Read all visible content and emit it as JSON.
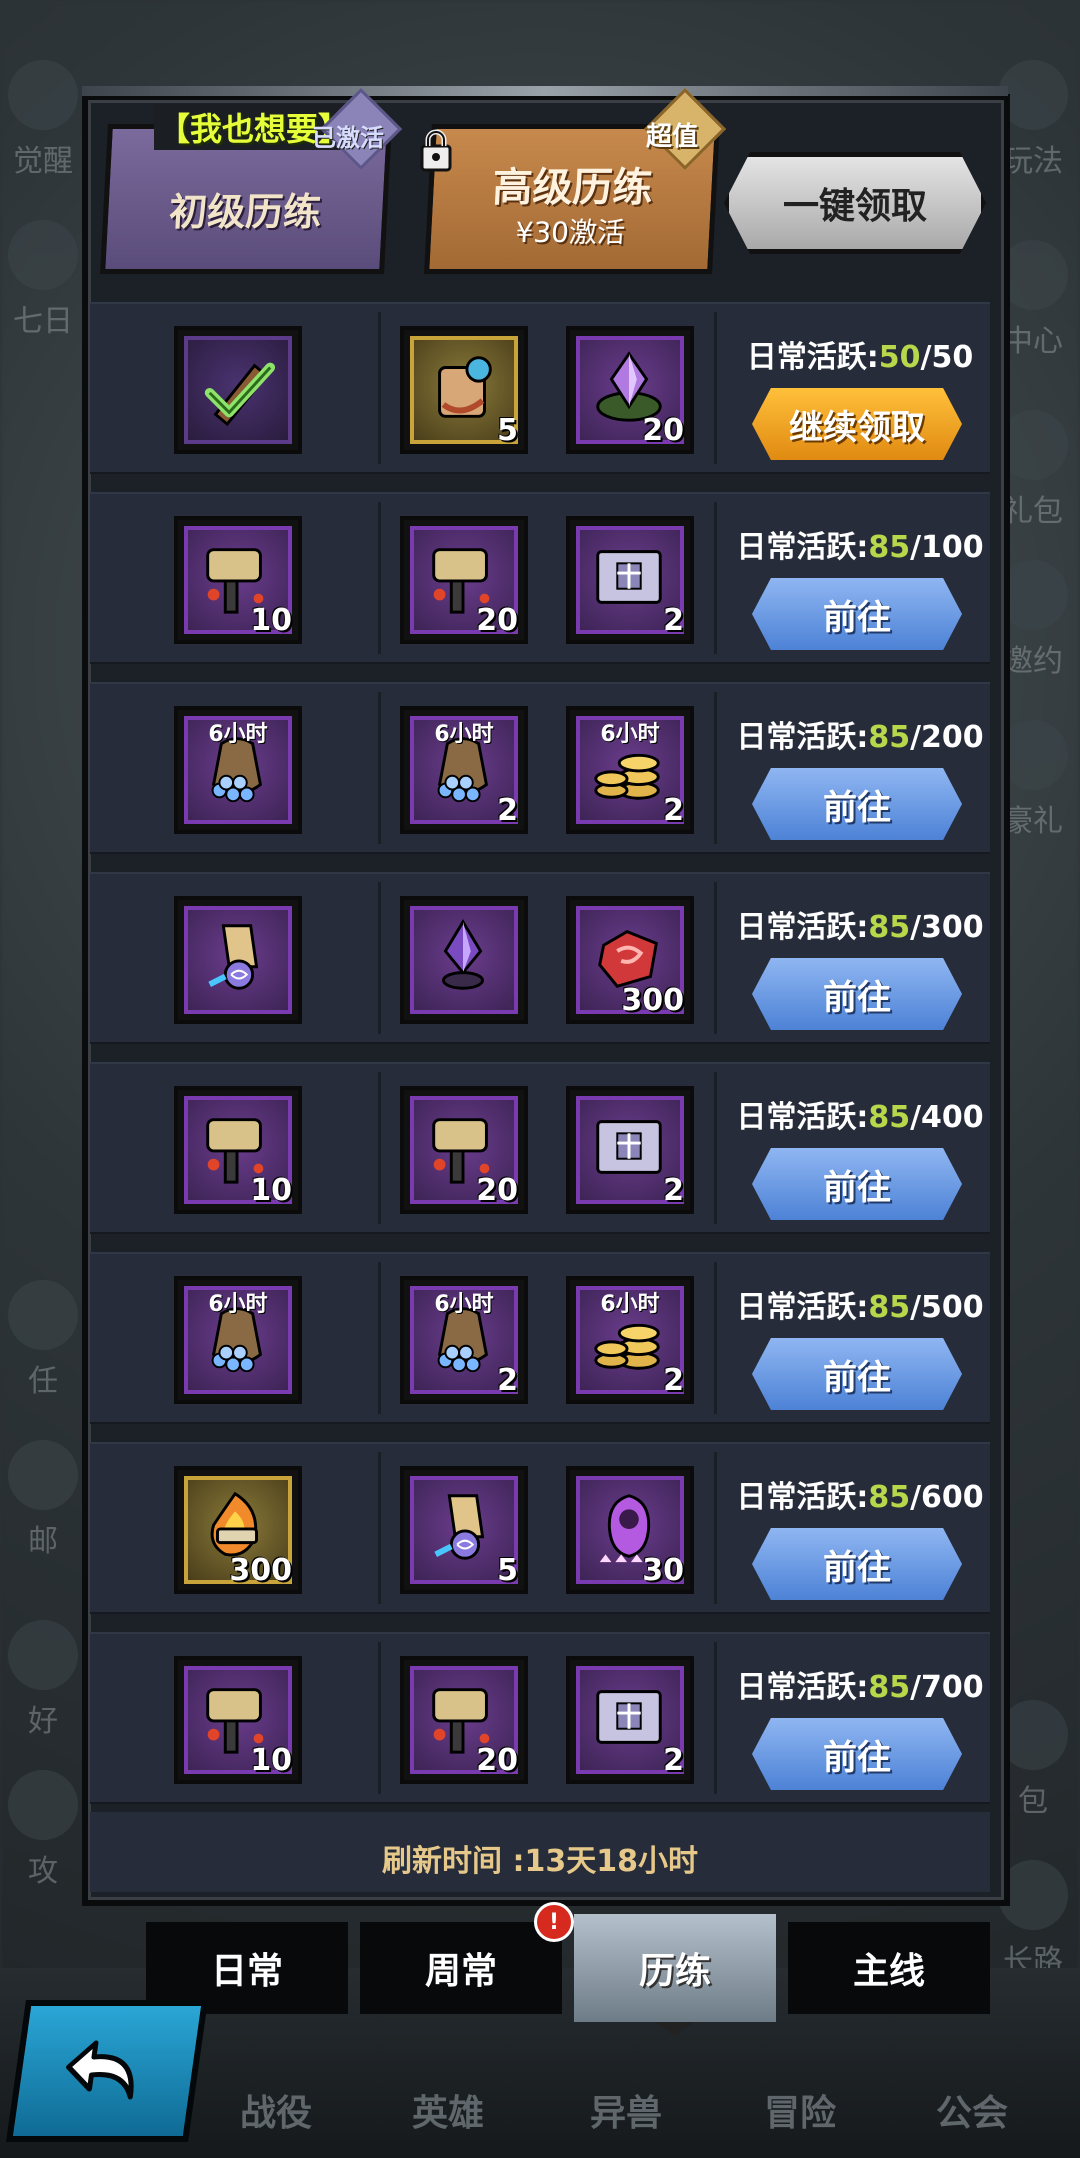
{
  "background": {
    "left_items": [
      "觉醒",
      "七日",
      "邮",
      "任",
      "好",
      "攻"
    ],
    "right_items": [
      "玩法",
      "中心",
      "礼包",
      "邀约",
      "豪礼",
      "包",
      "长路"
    ],
    "bottom_nav": [
      "战役",
      "英雄",
      "异兽",
      "冒险",
      "公会"
    ]
  },
  "header": {
    "want_label": "【我也想要】",
    "basic_tab_label": "初级历练",
    "basic_badge": "已激活",
    "advanced_tab_label": "高级历练",
    "advanced_price": "¥30激活",
    "advanced_badge": "超值",
    "claim_all_label": "一键领取"
  },
  "progress_prefix": "日常活跃:",
  "rows": [
    {
      "current": "50",
      "target": "/50",
      "button": "继续领取",
      "button_type": "continue",
      "items": [
        {
          "icon": "scroll-claimed-icon",
          "count": "",
          "timer": "",
          "frame": "dark",
          "claimed": true
        },
        {
          "icon": "gold-scroll-icon",
          "count": "5",
          "timer": "",
          "frame": "gold"
        },
        {
          "icon": "crystal-nest-icon",
          "count": "20",
          "timer": "",
          "frame": "purple"
        }
      ]
    },
    {
      "current": "85",
      "target": "/100",
      "button": "前往",
      "button_type": "go",
      "items": [
        {
          "icon": "hammer-icon",
          "count": "10",
          "timer": "",
          "frame": "purple"
        },
        {
          "icon": "hammer-icon",
          "count": "20",
          "timer": "",
          "frame": "purple"
        },
        {
          "icon": "gift-card-icon",
          "count": "2",
          "timer": "",
          "frame": "purple"
        }
      ]
    },
    {
      "current": "85",
      "target": "/200",
      "button": "前往",
      "button_type": "go",
      "items": [
        {
          "icon": "gem-bag-icon",
          "count": "",
          "timer": "6小时",
          "frame": "purple"
        },
        {
          "icon": "gem-bag-icon",
          "count": "2",
          "timer": "6小时",
          "frame": "purple"
        },
        {
          "icon": "gold-coins-icon",
          "count": "2",
          "timer": "6小时",
          "frame": "purple"
        }
      ]
    },
    {
      "current": "85",
      "target": "/300",
      "button": "前往",
      "button_type": "go",
      "items": [
        {
          "icon": "magic-scroll-icon",
          "count": "",
          "timer": "",
          "frame": "purple"
        },
        {
          "icon": "dark-crystal-icon",
          "count": "",
          "timer": "",
          "frame": "purple"
        },
        {
          "icon": "red-gem-icon",
          "count": "300",
          "timer": "",
          "frame": "purple"
        }
      ]
    },
    {
      "current": "85",
      "target": "/400",
      "button": "前往",
      "button_type": "go",
      "items": [
        {
          "icon": "hammer-icon",
          "count": "10",
          "timer": "",
          "frame": "purple"
        },
        {
          "icon": "hammer-icon",
          "count": "20",
          "timer": "",
          "frame": "purple"
        },
        {
          "icon": "gift-card-icon",
          "count": "2",
          "timer": "",
          "frame": "purple"
        }
      ]
    },
    {
      "current": "85",
      "target": "/500",
      "button": "前往",
      "button_type": "go",
      "items": [
        {
          "icon": "gem-bag-icon",
          "count": "",
          "timer": "6小时",
          "frame": "purple"
        },
        {
          "icon": "gem-bag-icon",
          "count": "2",
          "timer": "6小时",
          "frame": "purple"
        },
        {
          "icon": "gold-coins-icon",
          "count": "2",
          "timer": "6小时",
          "frame": "purple"
        }
      ]
    },
    {
      "current": "85",
      "target": "/600",
      "button": "前往",
      "button_type": "go",
      "items": [
        {
          "icon": "fire-scroll-icon",
          "count": "300",
          "timer": "",
          "frame": "gold"
        },
        {
          "icon": "magic-scroll-icon",
          "count": "5",
          "timer": "",
          "frame": "purple"
        },
        {
          "icon": "hero-shard-icon",
          "count": "30",
          "timer": "",
          "frame": "purple"
        }
      ]
    },
    {
      "current": "85",
      "target": "/700",
      "button": "前往",
      "button_type": "go",
      "items": [
        {
          "icon": "hammer-icon",
          "count": "10",
          "timer": "",
          "frame": "purple"
        },
        {
          "icon": "hammer-icon",
          "count": "20",
          "timer": "",
          "frame": "purple"
        },
        {
          "icon": "gift-card-icon",
          "count": "2",
          "timer": "",
          "frame": "purple"
        }
      ]
    }
  ],
  "refresh_text": "刷新时间 :13天18小时",
  "bottom_tabs": [
    "日常",
    "周常",
    "历练",
    "主线"
  ],
  "active_tab_index": 2,
  "alert_badge": "!",
  "colors": {
    "accent_green": "#b6d84a",
    "go_button": "#4d82d6",
    "continue_button": "#e08a12"
  }
}
